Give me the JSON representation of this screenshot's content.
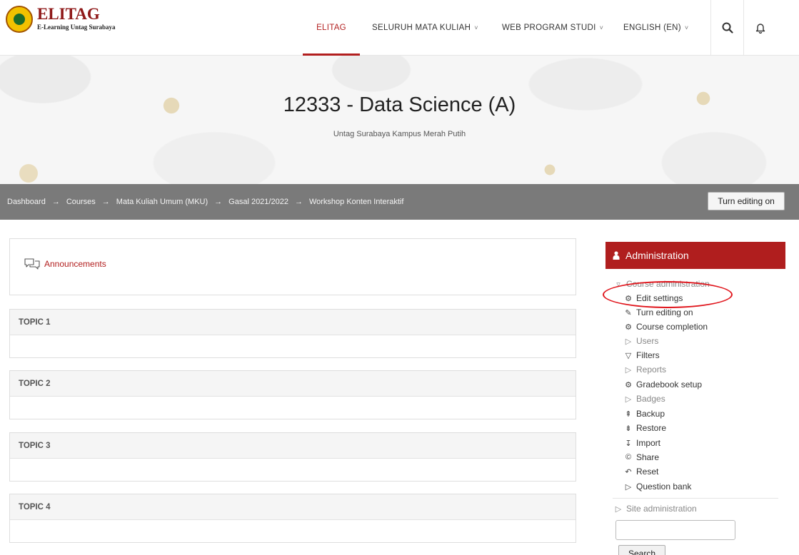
{
  "header": {
    "logo_title": "ELITAG",
    "logo_subtitle": "E-Learning Untag Surabaya",
    "nav": {
      "home": "ELITAG",
      "courses": "SELURUH MATA KULIAH",
      "program": "WEB PROGRAM STUDI",
      "language": "ENGLISH (EN)"
    },
    "caret": "˅"
  },
  "hero": {
    "title": "12333 - Data Science (A)",
    "subtitle": "Untag Surabaya Kampus Merah Putih"
  },
  "breadcrumb": {
    "items": [
      "Dashboard",
      "Courses",
      "Mata Kuliah Umum (MKU)",
      "Gasal 2021/2022",
      "Workshop Konten Interaktif"
    ],
    "separator": "→"
  },
  "toolbar": {
    "turn_editing_label": "Turn editing on"
  },
  "main": {
    "announcements_label": "Announcements",
    "topics": [
      "TOPIC 1",
      "TOPIC 2",
      "TOPIC 3",
      "TOPIC 4"
    ]
  },
  "administration": {
    "title": "Administration",
    "course_admin_label": "Course administration",
    "items": [
      {
        "label": "Edit settings",
        "icon": "gear-icon"
      },
      {
        "label": "Turn editing on",
        "icon": "pencil-icon"
      },
      {
        "label": "Course completion",
        "icon": "gear-icon"
      },
      {
        "label": "Users",
        "icon": "triangle-right-icon"
      },
      {
        "label": "Filters",
        "icon": "filter-icon"
      },
      {
        "label": "Reports",
        "icon": "triangle-right-icon"
      },
      {
        "label": "Gradebook setup",
        "icon": "gear-icon"
      },
      {
        "label": "Badges",
        "icon": "triangle-right-icon"
      },
      {
        "label": "Backup",
        "icon": "backup-icon"
      },
      {
        "label": "Restore",
        "icon": "restore-icon"
      },
      {
        "label": "Import",
        "icon": "import-icon"
      },
      {
        "label": "Share",
        "icon": "share-icon"
      },
      {
        "label": "Reset",
        "icon": "reset-icon"
      },
      {
        "label": "Question bank",
        "icon": "triangle-right-icon"
      }
    ],
    "site_admin_label": "Site administration",
    "search_button_label": "Search"
  },
  "colors": {
    "brand": "#b01e1e",
    "breadcrumb_bg": "#7a7a7a",
    "highlight_circle": "#e0141b"
  }
}
